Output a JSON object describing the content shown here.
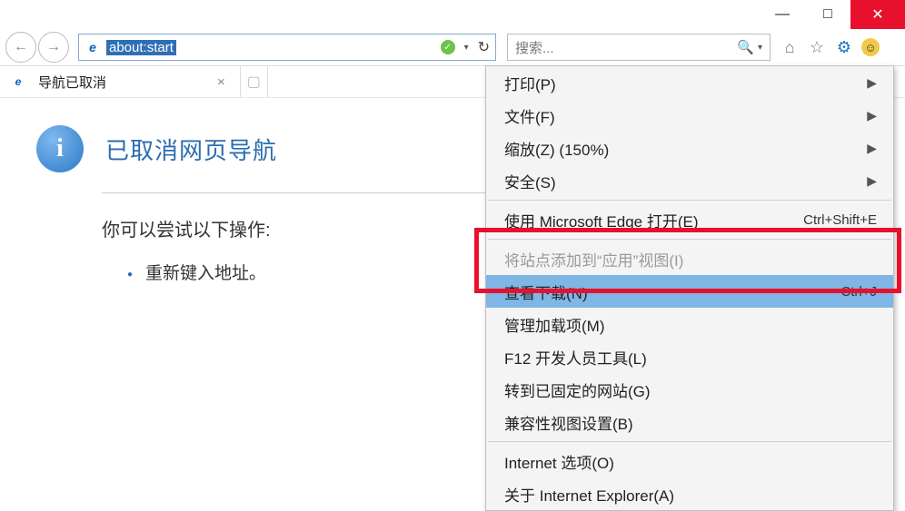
{
  "window": {
    "minimize": "—",
    "maximize": "□",
    "close": "✕"
  },
  "nav": {
    "url": "about:start",
    "search_placeholder": "搜索...",
    "icons": {
      "home": "⌂",
      "star": "☆",
      "gear": "⚙",
      "smile": "☺"
    }
  },
  "tab": {
    "title": "导航已取消",
    "close": "×"
  },
  "page": {
    "heading": "已取消网页导航",
    "try_label": "你可以尝试以下操作:",
    "action_1": "重新键入地址。"
  },
  "menu": {
    "print": "打印(P)",
    "file": "文件(F)",
    "zoom": "缩放(Z) (150%)",
    "safety": "安全(S)",
    "open_edge": "使用 Microsoft Edge 打开(E)",
    "open_edge_shortcut": "Ctrl+Shift+E",
    "add_site": "将站点添加到“应用”视图(I)",
    "view_downloads": "查看下载(N)",
    "view_downloads_shortcut": "Ctrl+J",
    "manage_addons": "管理加载项(M)",
    "f12": "F12 开发人员工具(L)",
    "pinned": "转到已固定的网站(G)",
    "compat": "兼容性视图设置(B)",
    "options": "Internet 选项(O)",
    "about": "关于 Internet Explorer(A)"
  }
}
